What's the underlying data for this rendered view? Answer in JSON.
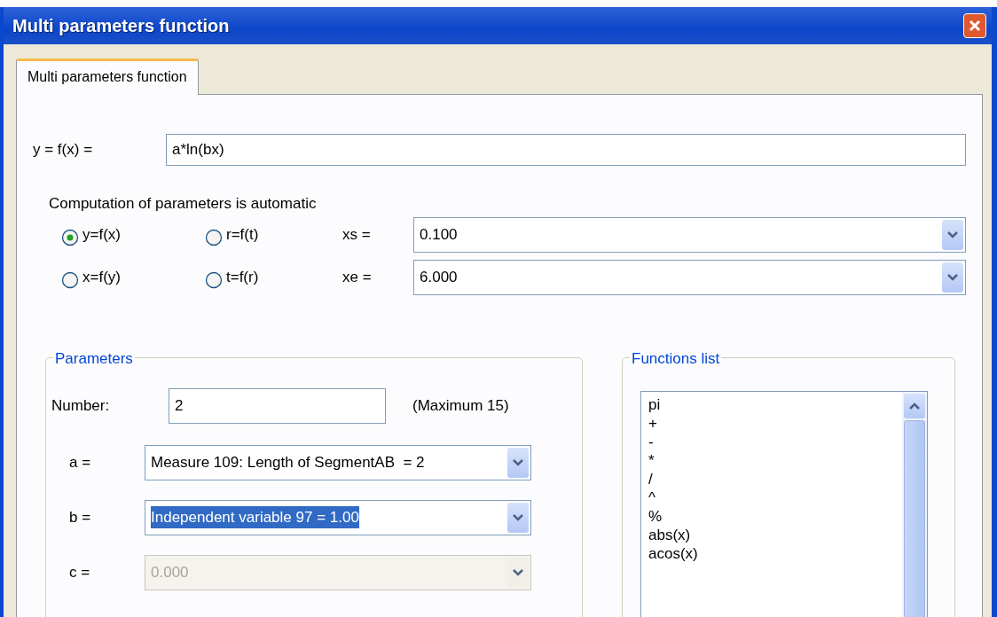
{
  "window": {
    "title": "Multi parameters function"
  },
  "tabs": [
    {
      "label": "Multi parameters function",
      "selected": true
    }
  ],
  "formula": {
    "label": "y = f(x) =",
    "value": "a*ln(bx)"
  },
  "note": "Computation of parameters is automatic",
  "modes": [
    {
      "label": "y=f(x)",
      "selected": true
    },
    {
      "label": "r=f(t)",
      "selected": false
    },
    {
      "label": "x=f(y)",
      "selected": false
    },
    {
      "label": "t=f(r)",
      "selected": false
    }
  ],
  "range": [
    {
      "label": "xs =",
      "value": "0.100"
    },
    {
      "label": "xe =",
      "value": "6.000"
    }
  ],
  "parameters": {
    "title": "Parameters",
    "number_label": "Number:",
    "number": "2",
    "max_note": "(Maximum 15)",
    "rows": [
      {
        "label": "a =",
        "value": "Measure 109: Length of SegmentAB  = 2",
        "highlighted": false,
        "disabled": false
      },
      {
        "label": "b =",
        "value": "Independent variable 97 = 1.00",
        "highlighted": true,
        "disabled": false
      },
      {
        "label": "c =",
        "value": "0.000",
        "highlighted": false,
        "disabled": true
      }
    ]
  },
  "functions_list": {
    "title": "Functions list",
    "items": [
      "pi",
      "+",
      "-",
      "*",
      "/",
      "^",
      "%",
      "abs(x)",
      "acos(x)"
    ]
  }
}
